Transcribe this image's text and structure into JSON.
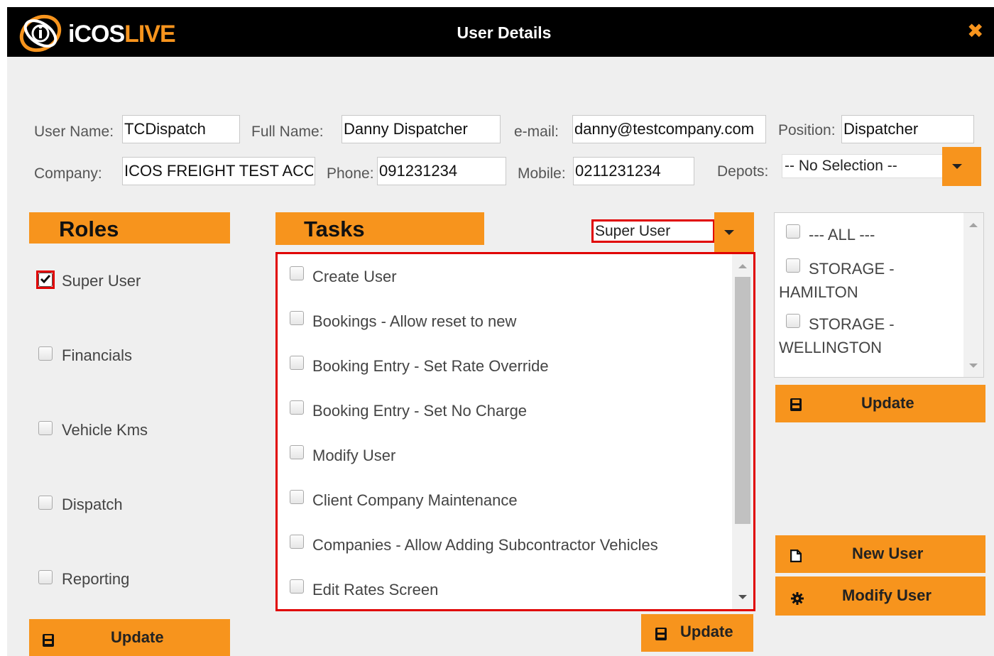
{
  "window": {
    "title": "User Details",
    "logo": {
      "text_white": "iCOS",
      "text_orange": "LIVE"
    },
    "close_glyph": "✖"
  },
  "form": {
    "username_label": "User Name:",
    "username_value": "TCDispatch",
    "fullname_label": "Full Name:",
    "fullname_value": "Danny Dispatcher",
    "email_label": "e-mail:",
    "email_value": "danny@testcompany.com",
    "position_label": "Position:",
    "position_value": "Dispatcher",
    "company_label": "Company:",
    "company_value": "ICOS FREIGHT TEST ACCOUNT",
    "phone_label": "Phone:",
    "phone_value": "091231234",
    "mobile_label": "Mobile:",
    "mobile_value": "0211231234",
    "depots_label": "Depots:",
    "depots_value": "-- No Selection --"
  },
  "roles": {
    "title": "Roles",
    "items": [
      {
        "label": "Super User",
        "checked": true
      },
      {
        "label": "Financials",
        "checked": false
      },
      {
        "label": "Vehicle Kms",
        "checked": false
      },
      {
        "label": "Dispatch",
        "checked": false
      },
      {
        "label": "Reporting",
        "checked": false
      }
    ],
    "update_label": "Update"
  },
  "tasks": {
    "title": "Tasks",
    "role_filter_value": "Super User",
    "items": [
      "Create User",
      "Bookings - Allow reset to new",
      "Booking Entry - Set Rate Override",
      "Booking Entry - Set No Charge",
      "Modify User",
      "Client Company Maintenance",
      "Companies - Allow Adding Subcontractor Vehicles",
      "Edit Rates Screen"
    ],
    "update_label": "Update"
  },
  "depots": {
    "items": [
      {
        "line1": "--- ALL ---",
        "line2": ""
      },
      {
        "line1": "STORAGE -",
        "line2": "HAMILTON"
      },
      {
        "line1": "STORAGE -",
        "line2": "WELLINGTON"
      }
    ],
    "update_label": "Update"
  },
  "actions": {
    "new_user_label": "New User",
    "modify_user_label": "Modify User"
  },
  "colors": {
    "accent": "#f7941d",
    "titlebar": "#000000",
    "highlight": "#e00000",
    "background": "#efefef"
  },
  "icons": [
    "logo-icon",
    "close-icon",
    "caret-down-icon",
    "save-icon",
    "new-file-icon",
    "gear-icon",
    "checkmark-icon",
    "scroll-up-icon",
    "scroll-down-icon"
  ]
}
